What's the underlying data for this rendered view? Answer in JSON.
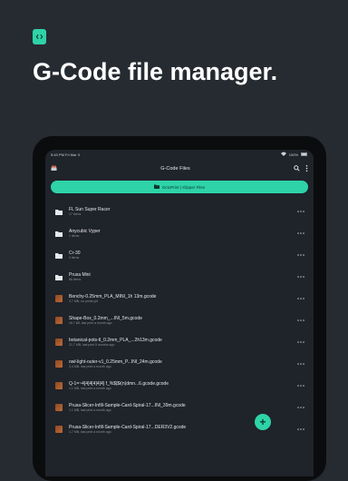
{
  "headline": "G-Code file manager.",
  "status": {
    "time": "5:43 PM",
    "date": "Fri Mar 3",
    "battery": "100%"
  },
  "appbar": {
    "title": "G-Code Files"
  },
  "chip": {
    "label": "OctoPrint | Klipper Files"
  },
  "items": [
    {
      "type": "folder",
      "name": "FL Sun Super Racer",
      "sub": "17 items"
    },
    {
      "type": "folder",
      "name": "Anycubic Vyper",
      "sub": "1 items"
    },
    {
      "type": "folder",
      "name": "Cr-30",
      "sub": "3 items"
    },
    {
      "type": "folder",
      "name": "Prusa Mini",
      "sub": "86 items"
    },
    {
      "type": "file",
      "name": "Benchy-0.25mm_PLA_MINI_1h 13m.gcode",
      "sub": "3.7 MB, no prints yet"
    },
    {
      "type": "file",
      "name": "Shape-Box_0.2mm_...INI_5m.gcode",
      "sub": "26.7 kB, last print a month ago"
    },
    {
      "type": "file",
      "name": "botanical-pots-tl_0.2mm_PLA_...2h13m.gcode",
      "sub": "21.7 MB, last print 5 months ago"
    },
    {
      "type": "file",
      "name": "owl-light-outer-v1_0.25mm_P...INI_24m.gcode",
      "sub": "3.4 MB, last print a month ago"
    },
    {
      "type": "file",
      "name": "Q-1=~4[4]4[4]4[4] f_%$|$i(n)dmn...6.gcode.gcode",
      "sub": "1.1 MB, last print a month ago"
    },
    {
      "type": "file",
      "name": "Prusa-Slicer-Infill-Sample-Card-Spiral-17...INI_39m.gcode",
      "sub": "1.1 MB, last print a month ago"
    },
    {
      "type": "file",
      "name": "Prusa-Slicer-Infill-Sample-Card-Spiral-17...DER3V2.gcode",
      "sub": "1.7 MB, last print a month ago"
    }
  ],
  "fab": {
    "label": "+"
  }
}
